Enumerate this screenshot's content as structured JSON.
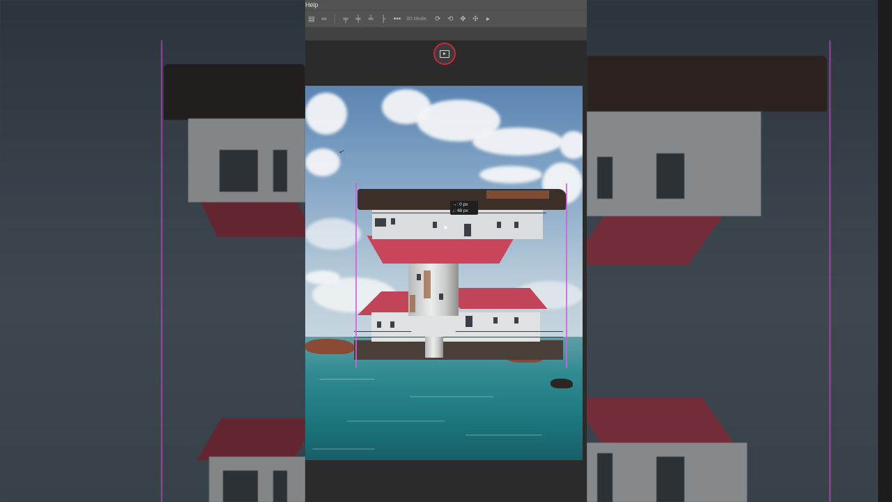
{
  "menubar": {
    "visible_menu": "Help"
  },
  "optionsbar": {
    "align_icons": [
      "align-left-edges-icon",
      "align-horizontal-centers-icon",
      "align-top-edges-icon",
      "align-vertical-centers-icon",
      "align-bottom-edges-icon",
      "align-left-icon"
    ],
    "more_label": "•••",
    "mode_label": "3D Mode:",
    "mode_icons": [
      "orbit-3d-icon",
      "roll-3d-icon",
      "pan-3d-icon",
      "slide-3d-icon",
      "scale-3d-icon"
    ]
  },
  "record_button": {
    "icon": "screen-record-icon",
    "accent": "#c8283a"
  },
  "transform_readout": {
    "dx_label": "0 px",
    "dy_label": "48 px"
  },
  "colors": {
    "guide": "#d060d8",
    "panel_bg": "#535353",
    "workspace_bg": "#2b2b2b"
  }
}
